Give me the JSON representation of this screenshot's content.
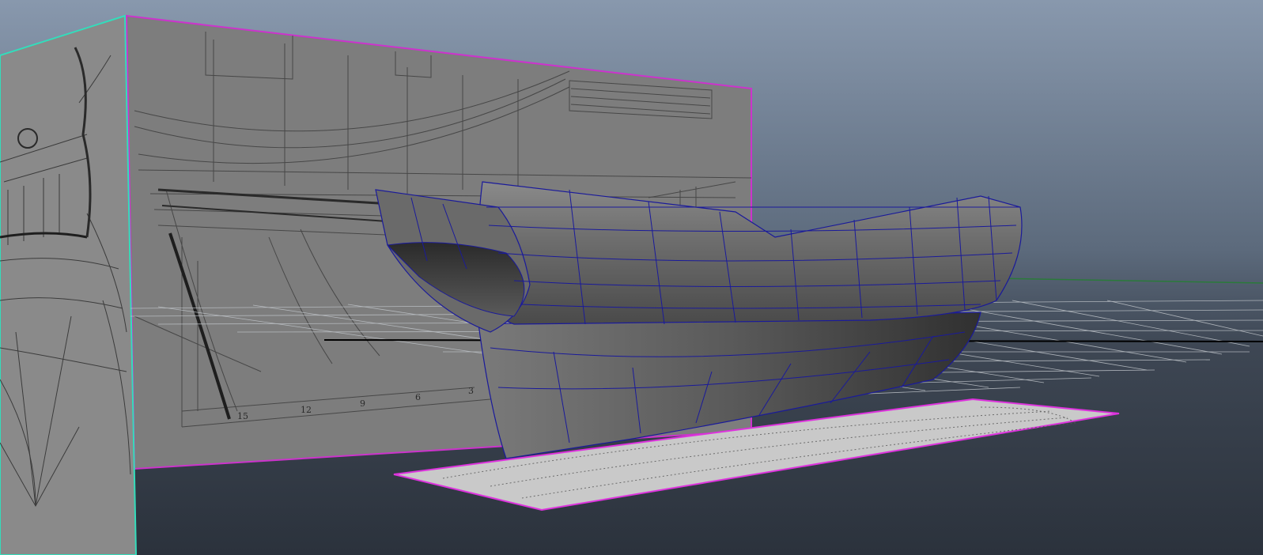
{
  "app": {
    "view": "perspective-viewport"
  },
  "scene": {
    "background_top_color": "#8595aa",
    "background_bottom_color": "#2e3540",
    "image_plane_side_border_color": "#cc33cc",
    "image_plane_front_border_color": "#33ddbb",
    "image_plane_bottom_border_color": "#dd33dd",
    "mesh_wire_color": "#1a1a9a",
    "grid_color": "#bfc4c8",
    "axis_x_color": "#000000",
    "axis_z_color": "#2a7a3a"
  },
  "blueprint_side": {
    "station_labels": [
      "15",
      "12",
      "9",
      "6",
      "3"
    ]
  },
  "objects": [
    {
      "name": "ship-hull-mesh",
      "type": "polygon-mesh"
    },
    {
      "name": "side-image-plane",
      "type": "image-plane"
    },
    {
      "name": "front-image-plane",
      "type": "image-plane"
    },
    {
      "name": "bottom-image-plane",
      "type": "image-plane"
    },
    {
      "name": "ground-grid",
      "type": "grid"
    }
  ]
}
